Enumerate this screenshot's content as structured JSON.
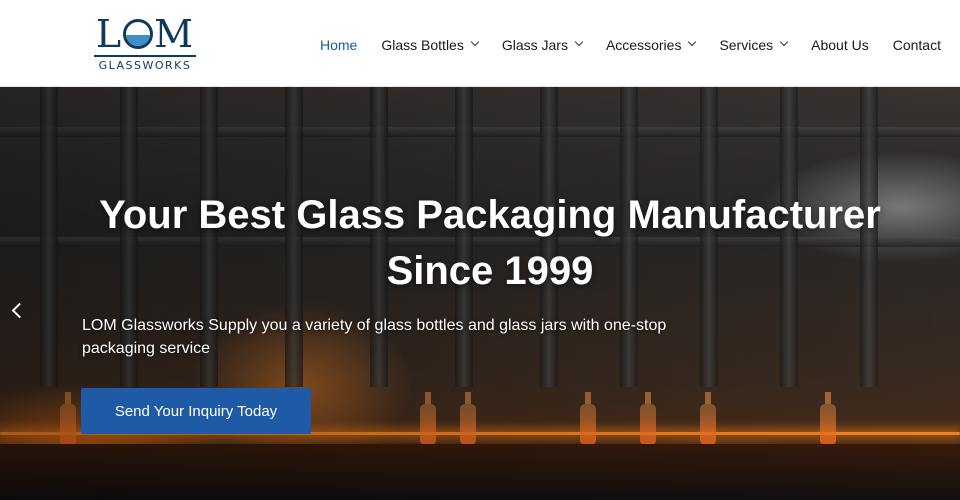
{
  "brand": {
    "logo_mark": "LOM",
    "logo_sub": "GLASSWORKS",
    "logo_color": "#0e3a5c",
    "accent": "#1f5aa6"
  },
  "nav": {
    "items": [
      {
        "label": "Home",
        "active": true,
        "has_dropdown": false
      },
      {
        "label": "Glass Bottles",
        "active": false,
        "has_dropdown": true
      },
      {
        "label": "Glass Jars",
        "active": false,
        "has_dropdown": true
      },
      {
        "label": "Accessories",
        "active": false,
        "has_dropdown": true
      },
      {
        "label": "Services",
        "active": false,
        "has_dropdown": true
      },
      {
        "label": "About Us",
        "active": false,
        "has_dropdown": false
      },
      {
        "label": "Contact",
        "active": false,
        "has_dropdown": false
      }
    ]
  },
  "hero": {
    "title_line1": "Your Best Glass Packaging Manufacturer",
    "title_line2": "Since 1999",
    "subtitle_line1": "LOM Glassworks Supply you a variety of glass bottles and glass jars with one-stop",
    "subtitle_line2": "packaging service",
    "cta_label": "Send Your Inquiry Today",
    "prev_icon": "chevron-left-icon"
  }
}
